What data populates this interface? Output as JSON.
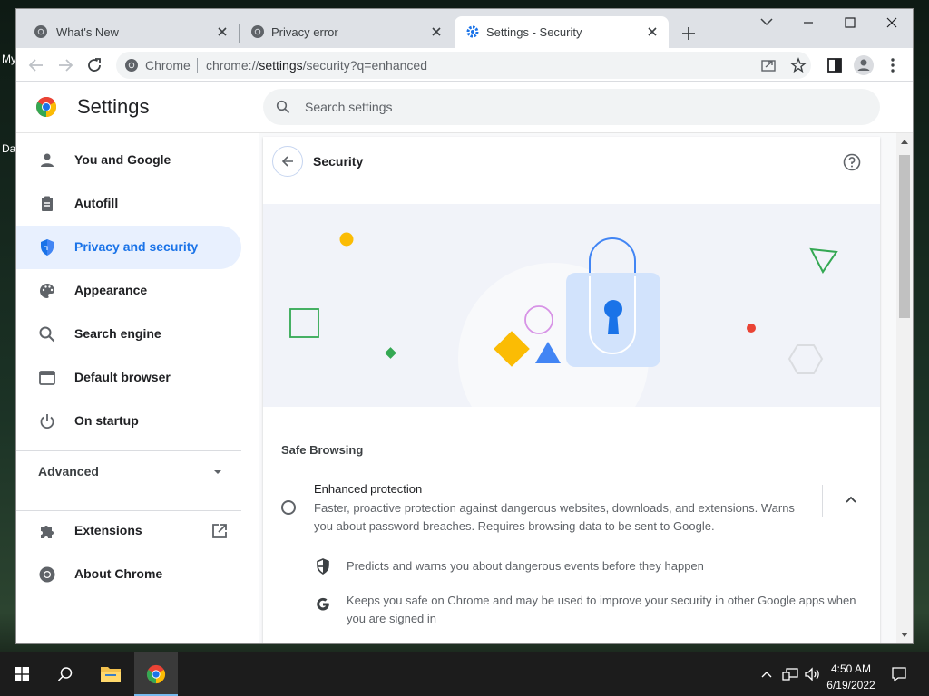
{
  "desktop": {
    "label1": "My",
    "label2": "Da"
  },
  "tabs": [
    {
      "title": "What's New",
      "icon": "chrome-icon"
    },
    {
      "title": "Privacy error",
      "icon": "globe-icon"
    },
    {
      "title": "Settings - Security",
      "icon": "gear-icon",
      "active": true
    }
  ],
  "toolbar": {
    "origin": "Chrome",
    "url_prefix": "chrome://",
    "url_host": "settings",
    "url_rest": "/security?q=enhanced"
  },
  "settings": {
    "title": "Settings",
    "search_placeholder": "Search settings"
  },
  "sidebar": {
    "items": [
      {
        "label": "You and Google",
        "icon": "person-icon"
      },
      {
        "label": "Autofill",
        "icon": "clipboard-icon"
      },
      {
        "label": "Privacy and security",
        "icon": "shield-icon",
        "selected": true
      },
      {
        "label": "Appearance",
        "icon": "palette-icon"
      },
      {
        "label": "Search engine",
        "icon": "search-icon"
      },
      {
        "label": "Default browser",
        "icon": "browser-icon"
      },
      {
        "label": "On startup",
        "icon": "power-icon"
      }
    ],
    "advanced": "Advanced",
    "extensions": "Extensions",
    "about": "About Chrome"
  },
  "page": {
    "title": "Security",
    "safe_browsing": "Safe Browsing",
    "enhanced": {
      "title": "Enhanced protection",
      "description": "Faster, proactive protection against dangerous websites, downloads, and extensions. Warns you about password breaches. Requires browsing data to be sent to Google."
    },
    "features": [
      {
        "text": "Predicts and warns you about dangerous events before they happen",
        "icon": "shield-icon"
      },
      {
        "text": "Keeps you safe on Chrome and may be used to improve your security in other Google apps when you are signed in",
        "icon": "google-g-icon"
      }
    ]
  },
  "taskbar": {
    "time": "4:50 AM",
    "date": "6/19/2022"
  },
  "colors": {
    "accent": "#1a73e8",
    "selected_bg": "#e8f0fe",
    "tabstrip": "#dee1e6"
  }
}
